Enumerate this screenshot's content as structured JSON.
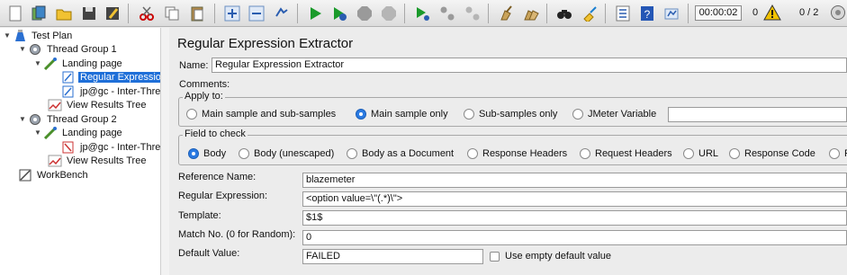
{
  "toolbar": {
    "buttons": [
      {
        "icon": "new-icon"
      },
      {
        "icon": "templates-icon"
      },
      {
        "icon": "open-icon"
      },
      {
        "icon": "save-icon"
      },
      {
        "icon": "save-as-icon"
      },
      {
        "icon": "cut-icon"
      },
      {
        "icon": "copy-icon"
      },
      {
        "icon": "paste-icon"
      },
      {
        "icon": "expand-icon"
      },
      {
        "icon": "collapse-icon"
      },
      {
        "icon": "toggle-icon"
      },
      {
        "icon": "start-icon"
      },
      {
        "icon": "start-no-pauses-icon"
      },
      {
        "icon": "stop-icon"
      },
      {
        "icon": "shutdown-icon"
      },
      {
        "icon": "remote-start-icon"
      },
      {
        "icon": "remote-stop-icon"
      },
      {
        "icon": "remote-shutdown-icon"
      },
      {
        "icon": "clear-icon"
      },
      {
        "icon": "clear-all-icon"
      },
      {
        "icon": "search-icon"
      },
      {
        "icon": "reset-search-icon"
      },
      {
        "icon": "function-helper-icon"
      },
      {
        "icon": "help-icon"
      },
      {
        "icon": "properties-icon"
      }
    ],
    "timer": "00:00:02",
    "error_count": "0",
    "threads": "0 / 2"
  },
  "tree": {
    "nodes": [
      {
        "label": "Test Plan",
        "icon": "test-plan-icon"
      },
      {
        "label": "Thread Group 1",
        "icon": "thread-group-icon"
      },
      {
        "label": "Landing page",
        "icon": "sampler-icon"
      },
      {
        "label": "Regular Expression",
        "icon": "extractor-icon",
        "selected": true
      },
      {
        "label": "jp@gc - Inter-Thre",
        "icon": "extractor-icon"
      },
      {
        "label": "View Results Tree",
        "icon": "listener-icon"
      },
      {
        "label": "Thread Group 2",
        "icon": "thread-group-icon"
      },
      {
        "label": "Landing page",
        "icon": "sampler-icon"
      },
      {
        "label": "jp@gc - Inter-Thre",
        "icon": "preprocessor-icon"
      },
      {
        "label": "View Results Tree",
        "icon": "listener-icon"
      },
      {
        "label": "WorkBench",
        "icon": "workbench-icon"
      }
    ]
  },
  "panel": {
    "title": "Regular Expression Extractor",
    "name_label": "Name:",
    "name_value": "Regular Expression Extractor",
    "comments_label": "Comments:",
    "apply_to": {
      "title": "Apply to:",
      "options": [
        "Main sample and sub-samples",
        "Main sample only",
        "Sub-samples only",
        "JMeter Variable"
      ],
      "selected": "Main sample only"
    },
    "field_to_check": {
      "title": "Field to check",
      "options": [
        "Body",
        "Body (unescaped)",
        "Body as a Document",
        "Response Headers",
        "Request Headers",
        "URL",
        "Response Code",
        "R"
      ],
      "selected": "Body"
    },
    "reference_name": {
      "label": "Reference Name:",
      "value": "blazemeter"
    },
    "regex": {
      "label": "Regular Expression:",
      "value": "<option value=\\\"(.*)\\\">"
    },
    "template": {
      "label": "Template:",
      "value": "$1$"
    },
    "match_no": {
      "label": "Match No. (0 for Random):",
      "value": "0"
    },
    "default_value": {
      "label": "Default Value:",
      "value": "FAILED"
    },
    "use_empty_default": {
      "label": "Use empty default value",
      "checked": false
    }
  },
  "colors": {
    "selection": "#1f6fd8",
    "radio_on": "#2a7ae2",
    "start_green": "#1a9a2a",
    "warning_yellow": "#f2c200"
  }
}
